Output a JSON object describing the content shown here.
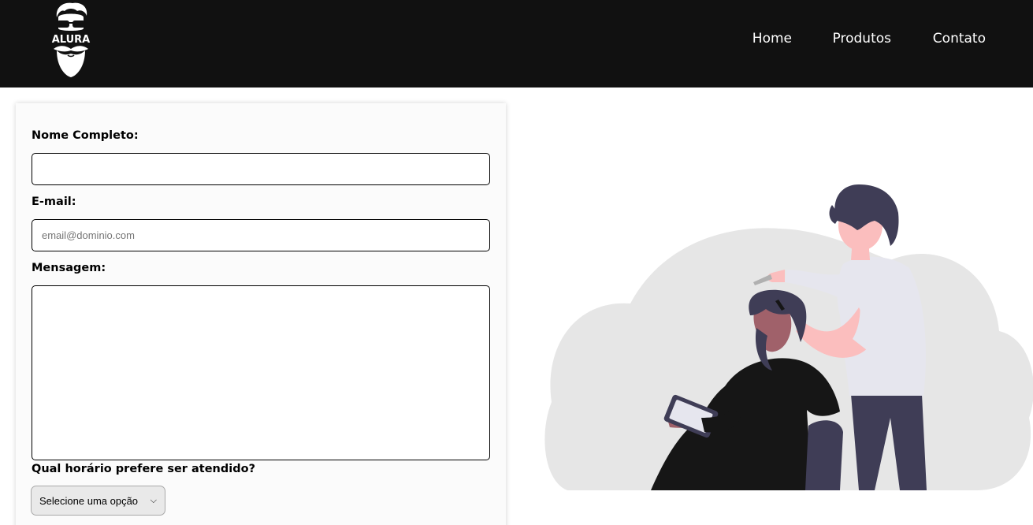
{
  "header": {
    "logo_text": "ALURA",
    "nav": [
      {
        "label": "Home"
      },
      {
        "label": "Produtos"
      },
      {
        "label": "Contato"
      }
    ]
  },
  "form": {
    "name_label": "Nome Completo:",
    "name_value": "",
    "email_label": "E-mail:",
    "email_value": "",
    "email_placeholder": "email@dominio.com",
    "message_label": "Mensagem:",
    "message_value": "",
    "schedule_label": "Qual horário prefere ser atendido?",
    "schedule_selected": "Selecione uma opção"
  },
  "icons": {
    "logo": "bearded-man-logo-icon",
    "select_arrow": "chevron-down-icon",
    "illustration": "barber-illustration"
  },
  "colors": {
    "header_bg": "#111111",
    "nav_text": "#ffffff",
    "cloud": "#e6e6e6",
    "hair": "#3f3d56",
    "skin": "#fbbebe",
    "shirt": "#e6e6ee",
    "cape": "#161616"
  }
}
